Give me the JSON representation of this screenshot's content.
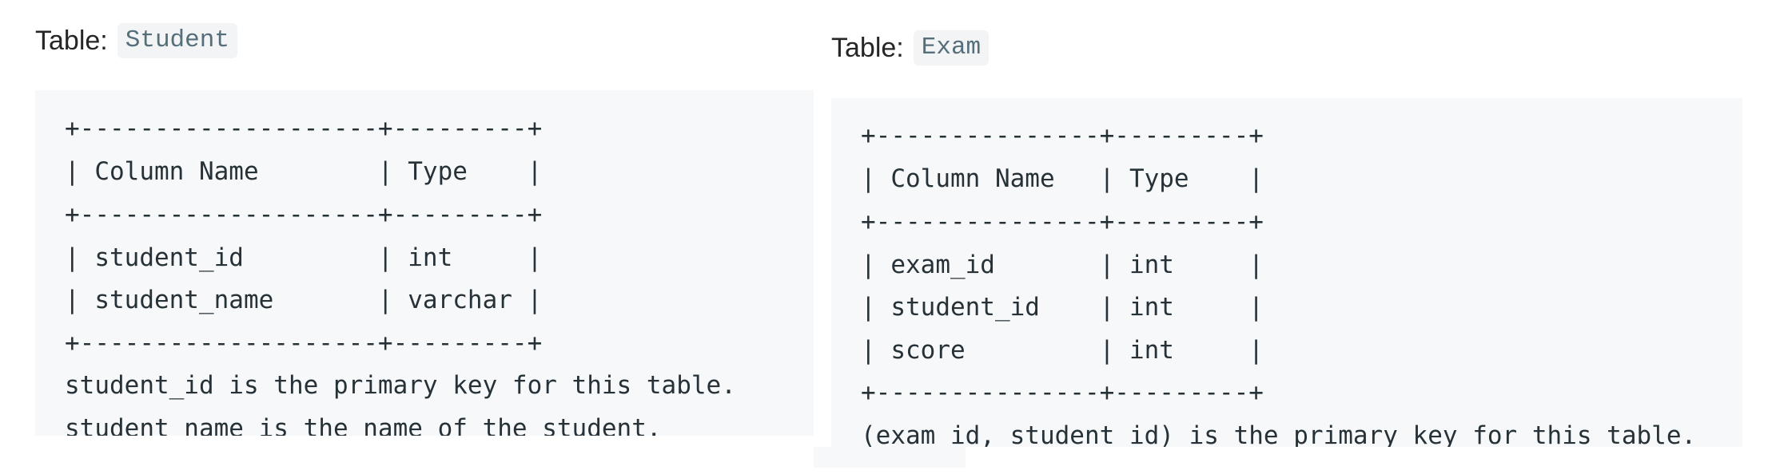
{
  "student_table": {
    "label": "Table:",
    "name": "Student",
    "lines": [
      "+--------------------+---------+",
      "| Column Name        | Type    |",
      "+--------------------+---------+",
      "| student_id         | int     |",
      "| student_name       | varchar |",
      "+--------------------+---------+",
      "student_id is the primary key for this table.",
      "student_name is the name of the student."
    ]
  },
  "exam_table": {
    "label": "Table:",
    "name": "Exam",
    "lines": [
      "+---------------+---------+",
      "| Column Name   | Type    |",
      "+---------------+---------+",
      "| exam_id       | int     |",
      "| student_id    | int     |",
      "| score         | int     |",
      "+---------------+---------+",
      "(exam_id, student_id) is the primary key for this table."
    ]
  }
}
